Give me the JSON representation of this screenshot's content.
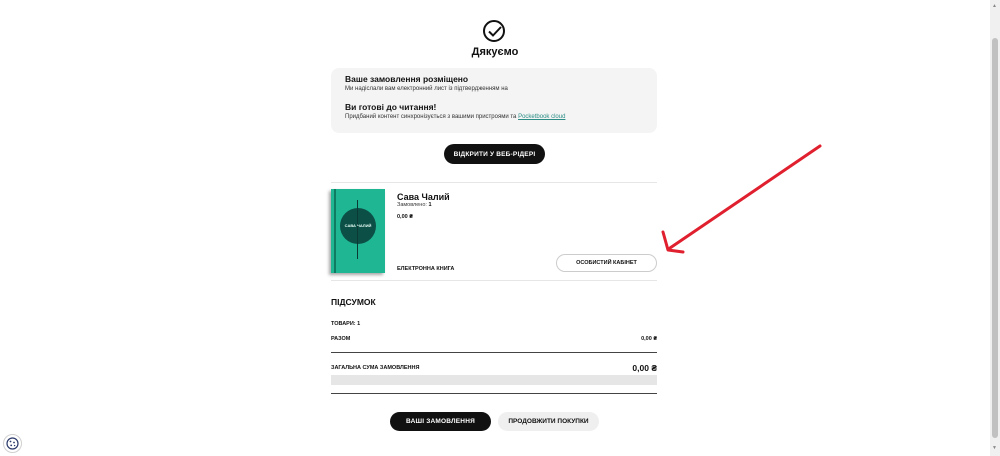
{
  "header": {
    "check_icon": "check-circle-icon",
    "title": "Дякуємо"
  },
  "confirmation": {
    "order_placed_heading": "Ваше замовлення розміщено",
    "order_placed_text": "Ми надіслали вам електронний лист із підтвердженням на",
    "ready_heading": "Ви готові до читання!",
    "ready_text": "Придбаний контент синхронізується з вашими пристроями та",
    "cloud_link": "Pocketbook cloud"
  },
  "open_reader_button": "ВІДКРИТИ У ВЕБ-РІДЕРІ",
  "book": {
    "title": "Сава Чалий",
    "ordered_label": "Замовлено:",
    "ordered_count": "1",
    "price": "0,00 ₴",
    "format": "ЕЛЕКТРОННА КНИГА",
    "cover_title": "САВА ЧАЛИЙ",
    "cabinet_button": "ОСОБИСТИЙ КАБІНЕТ"
  },
  "summary": {
    "title": "ПІДСУМОК",
    "items_label": "ТОВАРИ: 1",
    "subtotal_label": "РАЗОМ",
    "subtotal_value": "0,00 ₴",
    "total_label": "ЗАГАЛЬНА СУМА ЗАМОВЛЕННЯ",
    "total_value": "0,00 ₴"
  },
  "actions": {
    "orders_button": "ВАШІ ЗАМОВЛЕННЯ",
    "continue_button": "ПРОДОВЖИТИ ПОКУПКИ"
  },
  "colors": {
    "accent_dark": "#111111",
    "cover_green": "#1fb693",
    "link_teal": "#2a8c84",
    "annotation_arrow": "#e0202e"
  },
  "icons": {
    "cookie": "cookie-settings-icon",
    "arrow": "annotation-arrow-icon"
  }
}
